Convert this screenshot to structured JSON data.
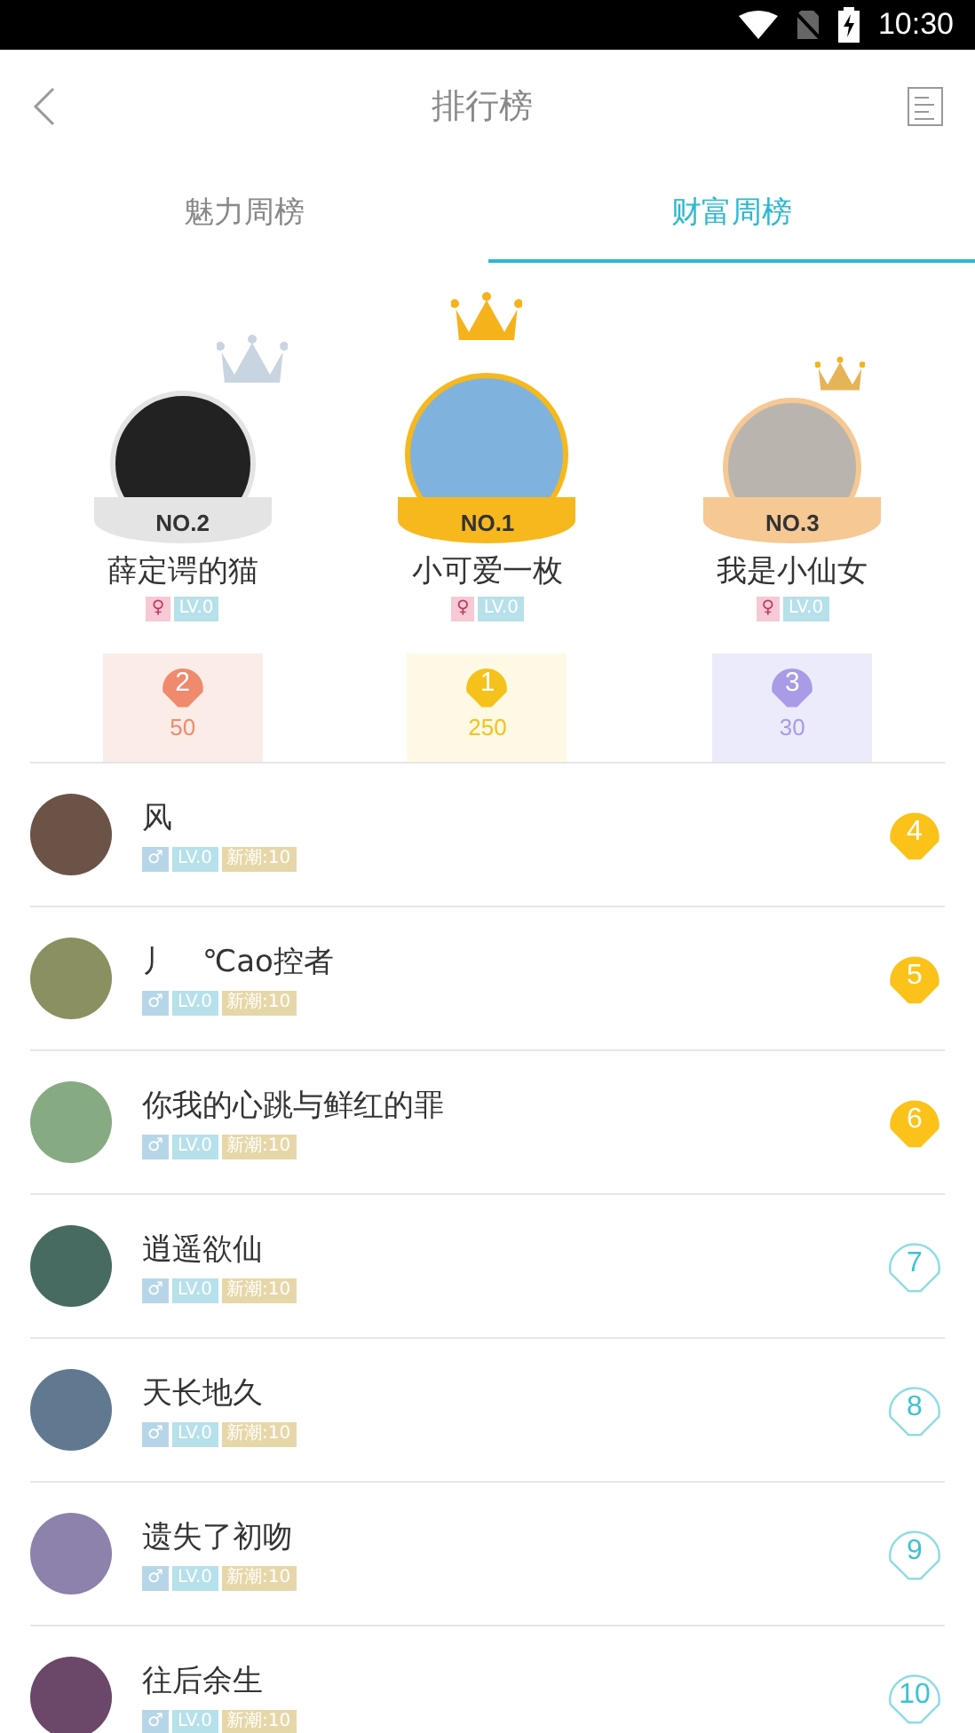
{
  "status_bar": {
    "time": "10:30"
  },
  "header": {
    "title": "排行榜"
  },
  "tabs": [
    {
      "label": "魅力周榜",
      "selected": false
    },
    {
      "label": "财富周榜",
      "selected": true
    }
  ],
  "podium": [
    {
      "rank_label": "NO.2",
      "name": "薛定谔的猫",
      "gender": "♀",
      "level": "LV.0",
      "shell_rank": "2",
      "score": "50",
      "color": "#f08a6c"
    },
    {
      "rank_label": "NO.1",
      "name": "小可爱一枚",
      "gender": "♀",
      "level": "LV.0",
      "shell_rank": "1",
      "score": "250",
      "color": "#f5c21b"
    },
    {
      "rank_label": "NO.3",
      "name": "我是小仙女",
      "gender": "♀",
      "level": "LV.0",
      "shell_rank": "3",
      "score": "30",
      "color": "#a99be6"
    }
  ],
  "ranking": [
    {
      "name": "风",
      "gender": "♂",
      "level": "LV.0",
      "tag": "新潮:10",
      "rank": "4",
      "kind": "filled"
    },
    {
      "name": "丿　℃ao控者",
      "gender": "♂",
      "level": "LV.0",
      "tag": "新潮:10",
      "rank": "5",
      "kind": "filled"
    },
    {
      "name": "你我的心跳与鲜红的罪",
      "gender": "♂",
      "level": "LV.0",
      "tag": "新潮:10",
      "rank": "6",
      "kind": "filled"
    },
    {
      "name": "逍遥欲仙",
      "gender": "♂",
      "level": "LV.0",
      "tag": "新潮:10",
      "rank": "7",
      "kind": "outline"
    },
    {
      "name": "天长地久",
      "gender": "♂",
      "level": "LV.0",
      "tag": "新潮:10",
      "rank": "8",
      "kind": "outline"
    },
    {
      "name": "遗失了初吻",
      "gender": "♂",
      "level": "LV.0",
      "tag": "新潮:10",
      "rank": "9",
      "kind": "outline"
    },
    {
      "name": "往后余生",
      "gender": "♂",
      "level": "LV.0",
      "tag": "新潮:10",
      "rank": "10",
      "kind": "outline"
    }
  ]
}
